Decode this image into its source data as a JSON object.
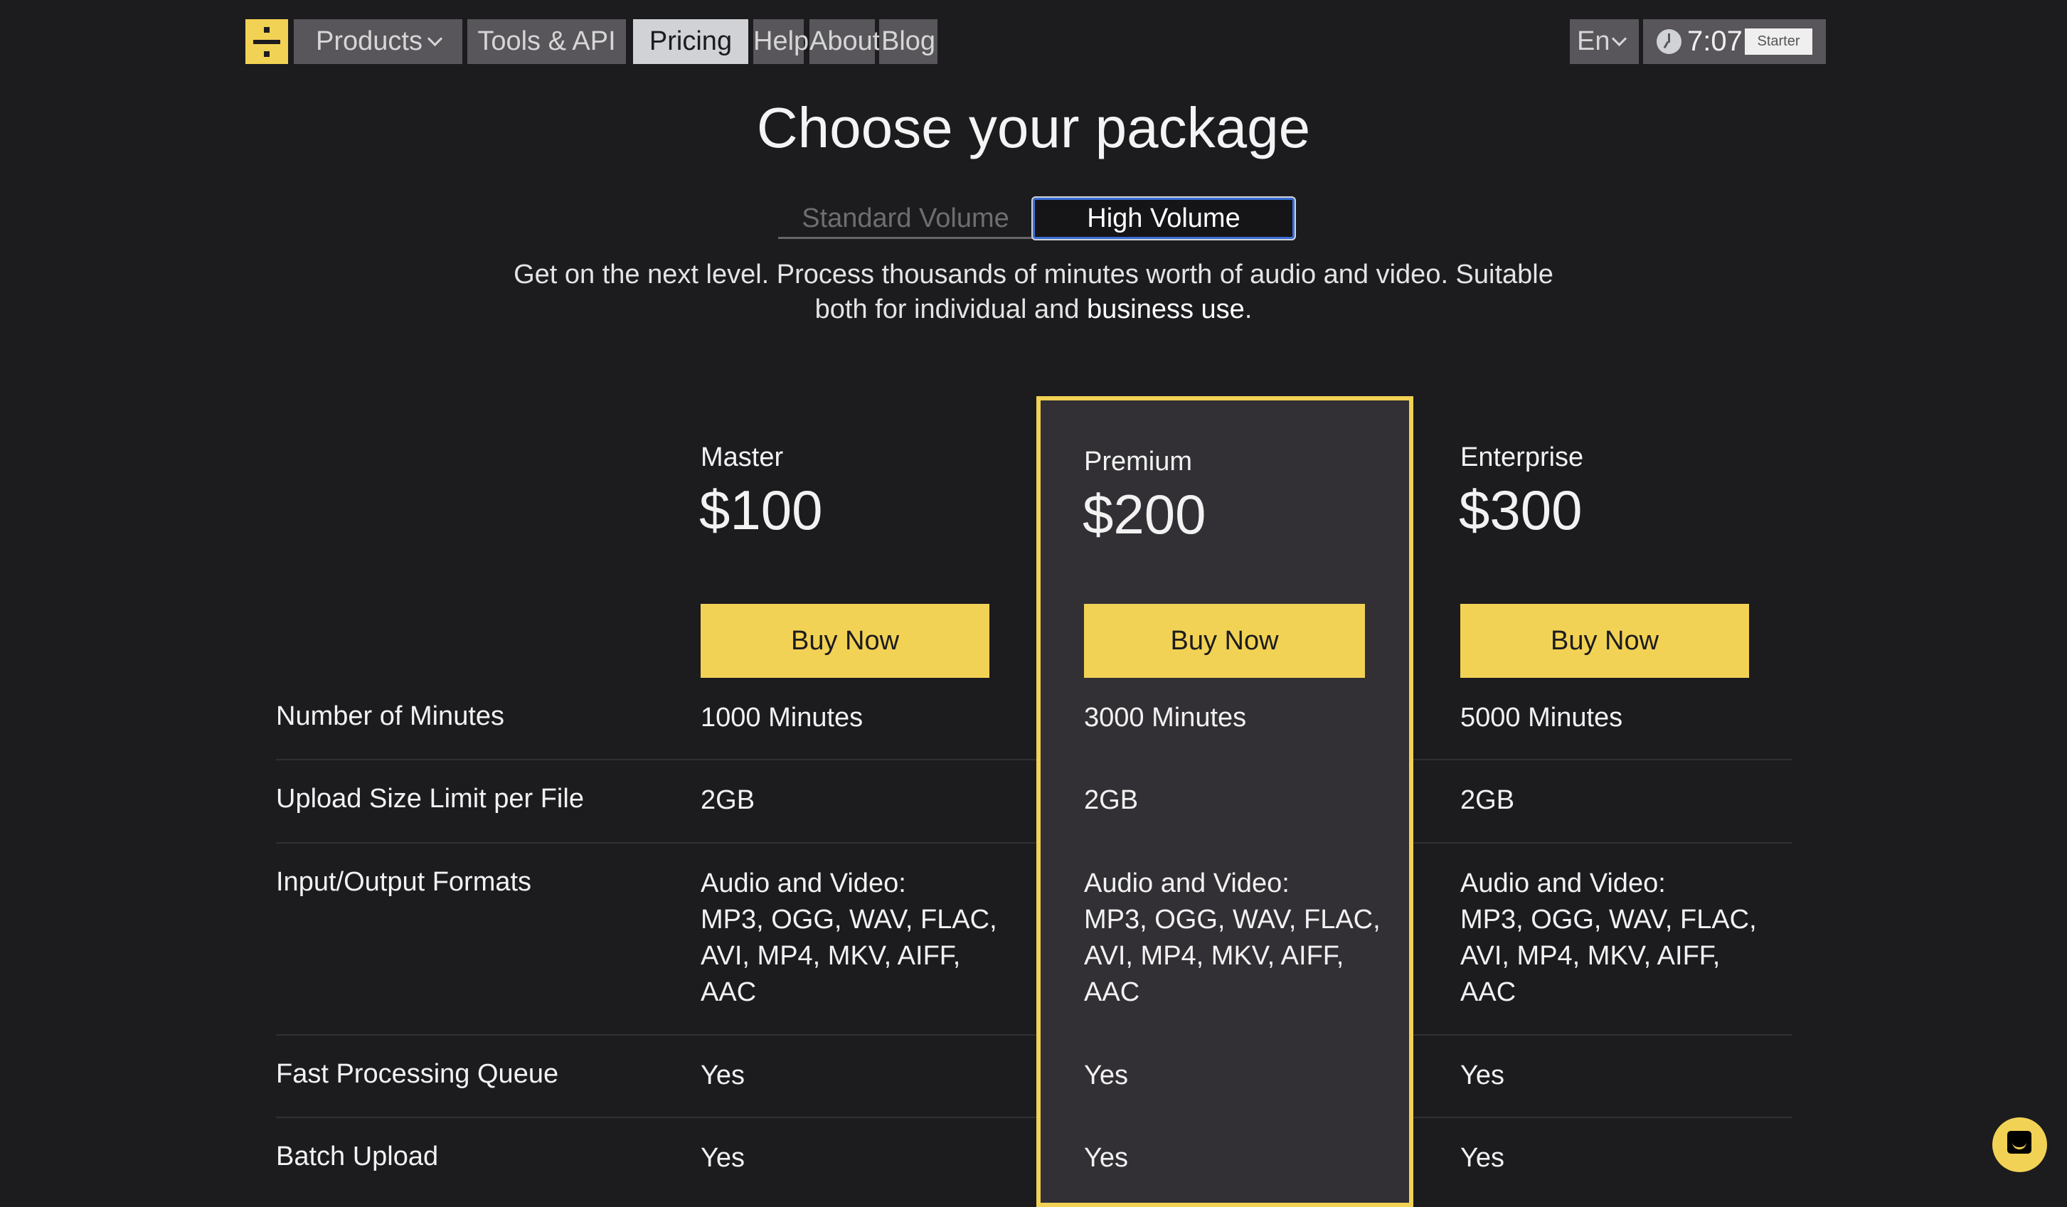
{
  "nav": {
    "items": [
      {
        "label": "Products",
        "has_dropdown": true
      },
      {
        "label": "Tools & API"
      },
      {
        "label": "Pricing",
        "active": true
      },
      {
        "label": "Help"
      },
      {
        "label": "About"
      },
      {
        "label": "Blog"
      }
    ],
    "language": "En",
    "time": "7:07",
    "plan_badge": "Starter"
  },
  "header": {
    "title": "Choose your package",
    "toggle": {
      "options": [
        "Standard Volume",
        "High Volume"
      ],
      "selected": "High Volume"
    },
    "description_main": "Get on the next level. Process thousands of minutes worth of audio and video. Suitable both for individual and ",
    "description_emphasis": "business use",
    "description_end": "."
  },
  "plans": [
    {
      "name": "Master",
      "price": "$100",
      "button": "Buy Now",
      "highlighted": false
    },
    {
      "name": "Premium",
      "price": "$200",
      "button": "Buy Now",
      "highlighted": true
    },
    {
      "name": "Enterprise",
      "price": "$300",
      "button": "Buy Now",
      "highlighted": false
    }
  ],
  "features": [
    {
      "label": "Number of Minutes",
      "values": [
        "1000 Minutes",
        "3000 Minutes",
        "5000 Minutes"
      ]
    },
    {
      "label": "Upload Size Limit per File",
      "values": [
        "2GB",
        "2GB",
        "2GB"
      ]
    },
    {
      "label": "Input/Output Formats",
      "values": [
        [
          "Audio and Video:",
          "MP3, OGG, WAV, FLAC,",
          "AVI, MP4, MKV, AIFF,",
          "AAC"
        ],
        [
          "Audio and Video:",
          "MP3, OGG, WAV, FLAC,",
          "AVI, MP4, MKV, AIFF,",
          "AAC"
        ],
        [
          "Audio and Video:",
          "MP3, OGG, WAV, FLAC,",
          "AVI, MP4, MKV, AIFF,",
          "AAC"
        ]
      ]
    },
    {
      "label": "Fast Processing Queue",
      "values": [
        "Yes",
        "Yes",
        "Yes"
      ]
    },
    {
      "label": "Batch Upload",
      "values": [
        "Yes",
        "Yes",
        "Yes"
      ]
    }
  ],
  "colors": {
    "accent": "#f2d255",
    "background": "#1c1b1e",
    "highlight_bg": "#323034",
    "nav_bg": "#58565a"
  },
  "chat": {
    "icon": "chat-bubble-icon"
  }
}
